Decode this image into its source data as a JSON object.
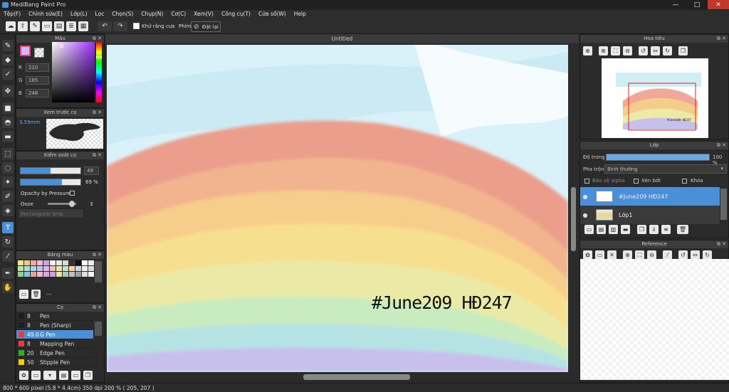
{
  "title": "MediBang Paint Pro",
  "window": {
    "minimize": "—",
    "maximize": "□",
    "close": "✕"
  },
  "menu": [
    "Tệp(F)",
    "Chỉnh sửa(E)",
    "Lớp(L)",
    "Lọc",
    "Chọn(S)",
    "Chụp(N)",
    "Cơ(C)",
    "Xem(V)",
    "Công cụ(T)",
    "Cửa sổ(W)",
    "Help"
  ],
  "toolbar": {
    "antialias": "Khử răng cưa",
    "keys": "Phím",
    "reset": "Đặt lại"
  },
  "color_panel": {
    "title": "Màu",
    "r_label": "R",
    "g_label": "G",
    "b_label": "B",
    "r": "210",
    "g": "185",
    "b": "246",
    "fg": "#d2b9f6"
  },
  "preview_panel": {
    "title": "Xem trước cọ",
    "size": "3.59mm"
  },
  "brush_control": {
    "title": "Kiểm soát cọ",
    "size_value": "49",
    "opacity_value": "69 %",
    "size_fraction": 0.5,
    "opacity_fraction": 0.69,
    "opacity_pressure": "Opacity by Pressure",
    "ooze_label": "Ooze",
    "ooze_value": "3",
    "tooltip": "Rectangular Snip"
  },
  "palette": {
    "title": "Bảng màu",
    "footer": "---",
    "colors": [
      "#f7e58a",
      "#f5c88a",
      "#f4a99d",
      "#f9b8c8",
      "#c9a8e8",
      "#f2f2f2",
      "#e8e8e8",
      "#d9d9d9",
      "#333333",
      "#111111",
      "#ffffff",
      "#f0f0f0",
      "#b9e6a8",
      "#a8e2d0",
      "#a8d8f0",
      "#b8c8f0",
      "#e0b8e8",
      "#f2c0c0",
      "#e8e8a0",
      "#c0e0c0",
      "#f8d0a0",
      "#d0d0f0",
      "#eeeeee",
      "#dddddd",
      "#90d090",
      "#80c8e0",
      "#e8a0a0",
      "#f0b8d0",
      "#d8a8d8",
      "#c8a0e0",
      "#f0e0a0",
      "#a0d0b0",
      "#c0c0c0",
      "#a0a0a0",
      "#e0e0e0",
      "#f8f8f8"
    ]
  },
  "brushes": {
    "title": "Cọ",
    "items": [
      {
        "size": "8",
        "name": "Pen",
        "color": "#1e1e1e"
      },
      {
        "size": "8",
        "name": "Pen (Sharp)",
        "color": "#1e1e1e"
      },
      {
        "size": "49.0",
        "name": "G Pen",
        "color": "#e63c3c",
        "selected": true
      },
      {
        "size": "8",
        "name": "Mapping Pen",
        "color": "#e63c3c"
      },
      {
        "size": "20",
        "name": "Edge Pen",
        "color": "#2eaa2e"
      },
      {
        "size": "50",
        "name": "Stipple Pen",
        "color": "#f0d000"
      }
    ]
  },
  "canvas": {
    "tab": "Untitled",
    "text": "#June209 HĐ247"
  },
  "navigator": {
    "title": "Hoa tiêu",
    "thumb_text": "#June209 HĐ247"
  },
  "layers": {
    "title": "Lớp",
    "opacity_label": "Độ trong",
    "opacity_value": "100 %",
    "opacity_fraction": 1.0,
    "blend_label": "Pha trộn",
    "blend_value": "Bình thường",
    "protect_alpha": "Bảo vệ alpha",
    "clipping": "Xén bớt",
    "lock": "Khóa",
    "items": [
      {
        "name": "#June209 HĐ247",
        "selected": true
      },
      {
        "name": "Lớp1",
        "selected": false
      }
    ]
  },
  "reference": {
    "title": "Reference"
  },
  "status": "800 * 600 pixel   (5.8 * 4.4cm)   350 dpi   200 %   ( 205, 207 )"
}
